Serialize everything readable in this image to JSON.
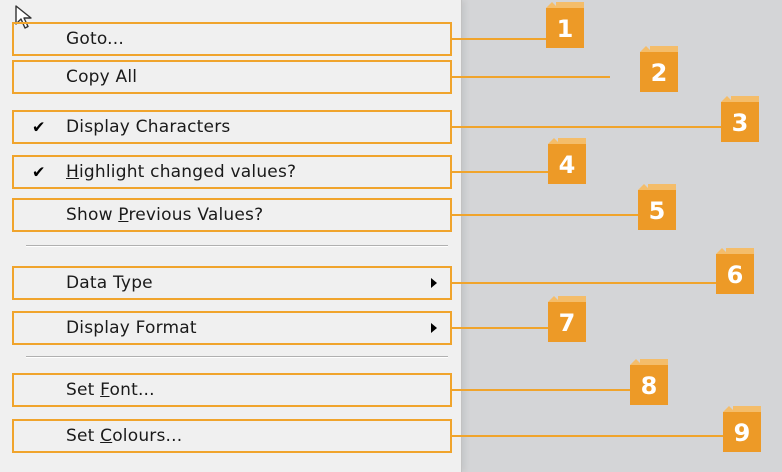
{
  "menu": {
    "items": [
      {
        "pre": "Goto...",
        "ul": "",
        "post": "",
        "checked": false,
        "submenu": false,
        "cursor": true
      },
      {
        "pre": "Copy All",
        "ul": "",
        "post": "",
        "checked": false,
        "submenu": false
      },
      {
        "pre": "Display Characters",
        "ul": "",
        "post": "",
        "checked": true,
        "submenu": false
      },
      {
        "pre": "",
        "ul": "H",
        "post": "ighlight changed values?",
        "checked": true,
        "submenu": false
      },
      {
        "pre": "Show ",
        "ul": "P",
        "post": "revious Values?",
        "checked": false,
        "submenu": false
      },
      {
        "pre": "Data Type",
        "ul": "",
        "post": "",
        "checked": false,
        "submenu": true
      },
      {
        "pre": "Display Format",
        "ul": "",
        "post": "",
        "checked": false,
        "submenu": true
      },
      {
        "pre": "Set ",
        "ul": "F",
        "post": "ont...",
        "checked": false,
        "submenu": false
      },
      {
        "pre": "Set ",
        "ul": "C",
        "post": "olours...",
        "checked": false,
        "submenu": false
      }
    ],
    "check_glyph": "✔"
  },
  "callouts": [
    "1",
    "2",
    "3",
    "4",
    "5",
    "6",
    "7",
    "8",
    "9"
  ],
  "colors": {
    "callout_fill": "#ed9a27",
    "callout_outline": "#f0a42c",
    "menu_background": "#f0f0f0",
    "page_background": "#d4d5d7"
  }
}
